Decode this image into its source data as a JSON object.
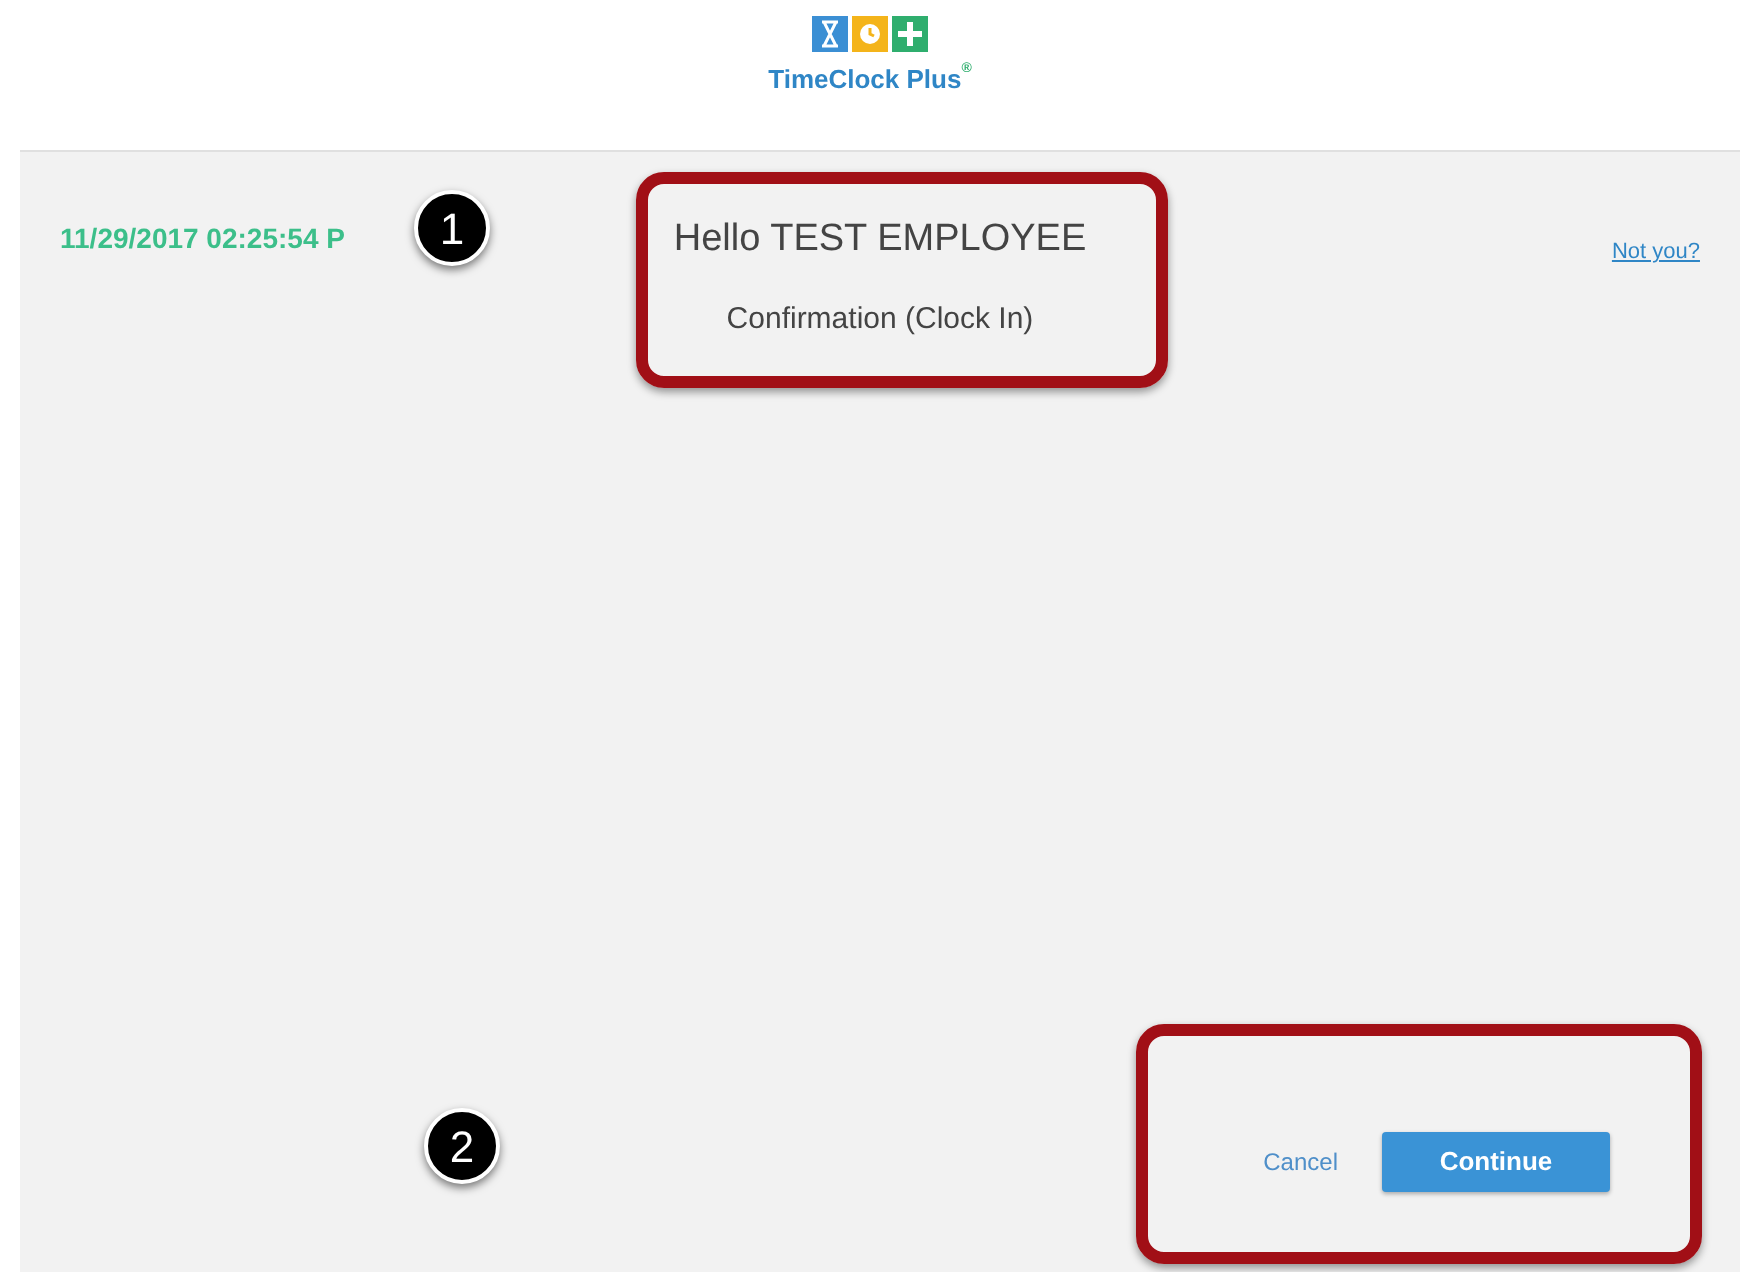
{
  "header": {
    "brand_name": "TimeClock Plus",
    "brand_mark": "®"
  },
  "panel": {
    "timestamp": "11/29/2017 02:25:54 P",
    "greeting": "Hello TEST EMPLOYEE",
    "subtitle": "Confirmation (Clock In)",
    "not_you_link": "Not you?"
  },
  "actions": [
    {
      "label": "Cancel",
      "kind": "link"
    },
    {
      "label": "Continue",
      "kind": "primary"
    }
  ],
  "callouts": [
    {
      "label": "1"
    },
    {
      "label": "2"
    }
  ]
}
